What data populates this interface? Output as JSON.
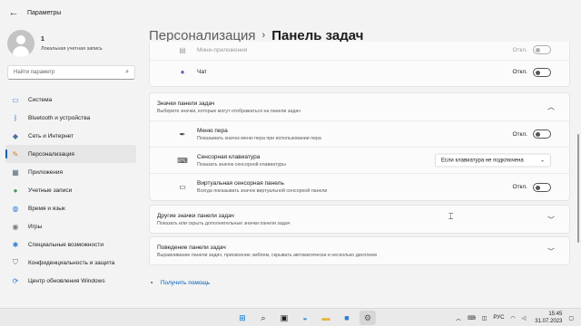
{
  "window": {
    "title": "Параметры"
  },
  "profile": {
    "name": "1",
    "subtitle": "Локальная учетная запись"
  },
  "search": {
    "placeholder": "Найти параметр"
  },
  "sidebar": {
    "items": [
      {
        "label": "Система",
        "icon": "monitor-icon",
        "color": "#2f7ddb"
      },
      {
        "label": "Bluetooth и устройства",
        "icon": "bluetooth-icon",
        "color": "#2f7ddb"
      },
      {
        "label": "Сеть и Интернет",
        "icon": "network-icon",
        "color": "#4a6fa5"
      },
      {
        "label": "Персонализация",
        "icon": "brush-icon",
        "color": "#d17c2c",
        "active": true
      },
      {
        "label": "Приложения",
        "icon": "apps-icon",
        "color": "#5a6b80"
      },
      {
        "label": "Учетные записи",
        "icon": "person-icon",
        "color": "#3aa057"
      },
      {
        "label": "Время и язык",
        "icon": "globe-icon",
        "color": "#2f7ddb"
      },
      {
        "label": "Игры",
        "icon": "gamepad-icon",
        "color": "#7a7a7a"
      },
      {
        "label": "Специальные возможности",
        "icon": "accessibility-icon",
        "color": "#2f7ddb"
      },
      {
        "label": "Конфиденциальность и защита",
        "icon": "shield-icon",
        "color": "#6b6b6b"
      },
      {
        "label": "Центр обновления Windows",
        "icon": "update-icon",
        "color": "#2f7ddb"
      }
    ]
  },
  "breadcrumb": {
    "parent": "Персонализация",
    "current": "Панель задач"
  },
  "top_card": {
    "items": [
      {
        "label": "Мини-приложения",
        "toggle": "Откл."
      },
      {
        "label": "Чат",
        "toggle": "Откл."
      }
    ]
  },
  "icons_section": {
    "title": "Значки панели задач",
    "subtitle": "Выберите значки, которые могут отображаться на панели задач",
    "items": [
      {
        "label": "Меню пера",
        "desc": "Показывать значок меню пера при использовании пера",
        "control": "Откл."
      },
      {
        "label": "Сенсорная клавиатура",
        "desc": "Показать значок сенсорной клавиатуры",
        "control": "Если клавиатура не подключена"
      },
      {
        "label": "Виртуальная сенсорная панель",
        "desc": "Всегда показывать значок виртуальной сенсорной панели",
        "control": "Откл."
      }
    ]
  },
  "other_section": {
    "title": "Другие значки панели задач",
    "subtitle": "Показать или скрыть дополнительные значки панели задач"
  },
  "behavior_section": {
    "title": "Поведение панели задач",
    "subtitle": "Выравнивание панели задач, присвоение эмблем, скрывать автоматически и несколько дисплеев"
  },
  "help": {
    "label": "Получить помощь"
  },
  "taskbar": {
    "tray": {
      "lang": "РУС",
      "time": "15:45",
      "date": "31.07.2023"
    }
  },
  "colors": {
    "accent": "#005fb8"
  }
}
